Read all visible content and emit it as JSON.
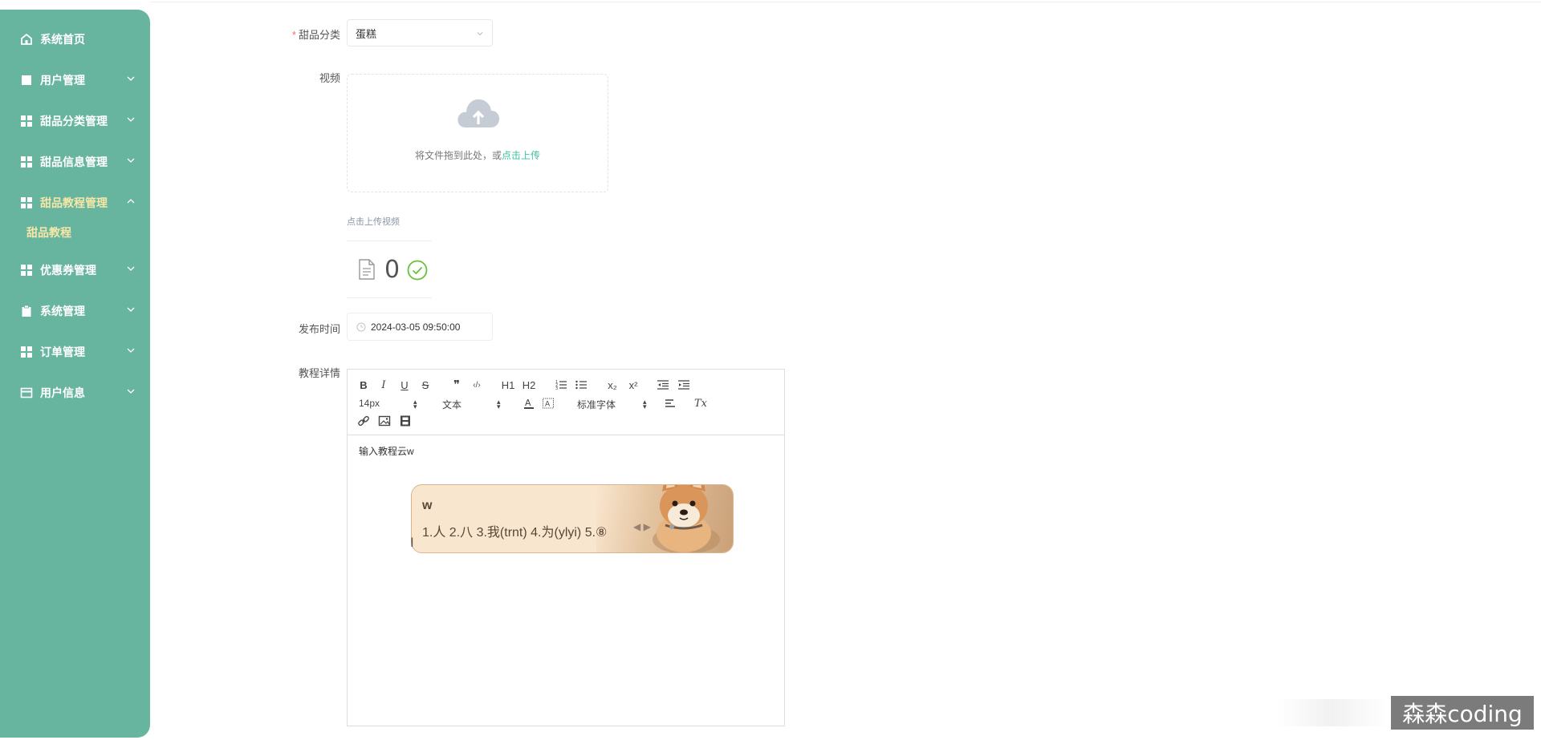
{
  "sidebar": {
    "items": [
      {
        "label": "系统首页",
        "icon": "home-icon"
      },
      {
        "label": "用户管理",
        "icon": "square-icon"
      },
      {
        "label": "甜品分类管理",
        "icon": "grid-icon"
      },
      {
        "label": "甜品信息管理",
        "icon": "grid-icon"
      },
      {
        "label": "甜品教程管理",
        "icon": "grid-icon",
        "expanded": true
      },
      {
        "label": "优惠券管理",
        "icon": "grid-icon"
      },
      {
        "label": "系统管理",
        "icon": "clipboard-icon"
      },
      {
        "label": "订单管理",
        "icon": "grid-icon"
      },
      {
        "label": "用户信息",
        "icon": "card-icon"
      }
    ],
    "sub_item": "甜品教程",
    "bg_color": "#67b49f"
  },
  "form": {
    "category_label": "甜品分类",
    "category_value": "蛋糕",
    "video_label": "视频",
    "upload_hint": "将文件拖到此处，或",
    "upload_link": "点击上传",
    "upload_tip": "点击上传视频",
    "file_count": "0",
    "publish_label": "发布时间",
    "publish_value": "2024-03-05 09:50:00",
    "detail_label": "教程详情"
  },
  "editor": {
    "toolbar": {
      "bold": "B",
      "italic": "I",
      "underline": "U",
      "strike": "S",
      "quote": "❞",
      "code": "‹/›",
      "h1": "H1",
      "h2": "H2",
      "ordered": "ol",
      "bullet": "ul",
      "sub": "x₂",
      "sup": "x²",
      "size": "14px",
      "format": "文本",
      "font": "标准字体",
      "clear": "Tx"
    },
    "content": "输入教程云w"
  },
  "ime": {
    "typed": "w",
    "candidates": "1.人  2.八  3.我(trnt)  4.为(ylyi)  5.⑧"
  },
  "watermark": "森森coding",
  "accent_color": "#3cc39f"
}
